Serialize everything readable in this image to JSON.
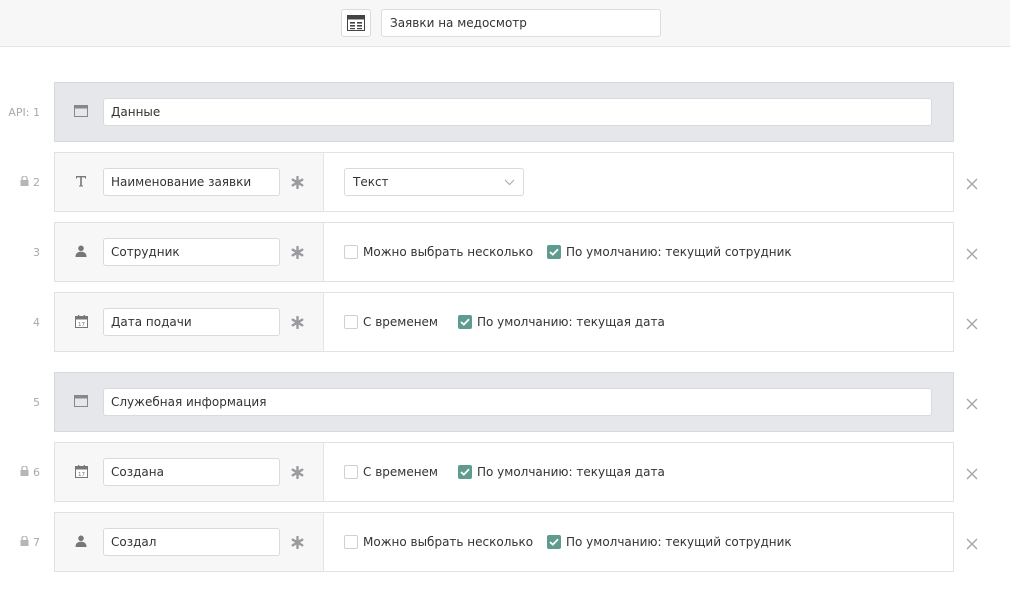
{
  "header": {
    "table_icon": "table-icon",
    "table_name": "Заявки на медосмотр"
  },
  "fields": [
    {
      "num": "API: 1",
      "locked": false,
      "kind": "section",
      "icon": "section-icon",
      "name": "Данные"
    },
    {
      "num": "2",
      "locked": true,
      "kind": "text",
      "icon": "text-type-icon",
      "name": "Наименование заявки",
      "type_label": "Текст"
    },
    {
      "num": "3",
      "locked": false,
      "kind": "user",
      "icon": "user-icon",
      "name": "Сотрудник",
      "opt1": "Можно выбрать несколько",
      "opt1_checked": false,
      "opt2": "По умолчанию: текущий сотрудник",
      "opt2_checked": true
    },
    {
      "num": "4",
      "locked": false,
      "kind": "date",
      "icon": "calendar-icon",
      "name": "Дата подачи",
      "opt1": "С временем",
      "opt1_checked": false,
      "opt2": "По умолчанию: текущая дата",
      "opt2_checked": true
    },
    {
      "num": "5",
      "locked": false,
      "kind": "section",
      "icon": "section-icon",
      "name": "Служебная информация"
    },
    {
      "num": "6",
      "locked": true,
      "kind": "date",
      "icon": "calendar-icon",
      "name": "Создана",
      "opt1": "С временем",
      "opt1_checked": false,
      "opt2": "По умолчанию: текущая дата",
      "opt2_checked": true
    },
    {
      "num": "7",
      "locked": true,
      "kind": "user",
      "icon": "user-icon",
      "name": "Создал",
      "opt1": "Можно выбрать несколько",
      "opt1_checked": false,
      "opt2": "По умолчанию: текущий сотрудник",
      "opt2_checked": true
    }
  ],
  "colors": {
    "accent_checkbox": "#5f9c8f",
    "section_bg": "#e6e7ea",
    "row_left_bg": "#f7f7f8"
  }
}
